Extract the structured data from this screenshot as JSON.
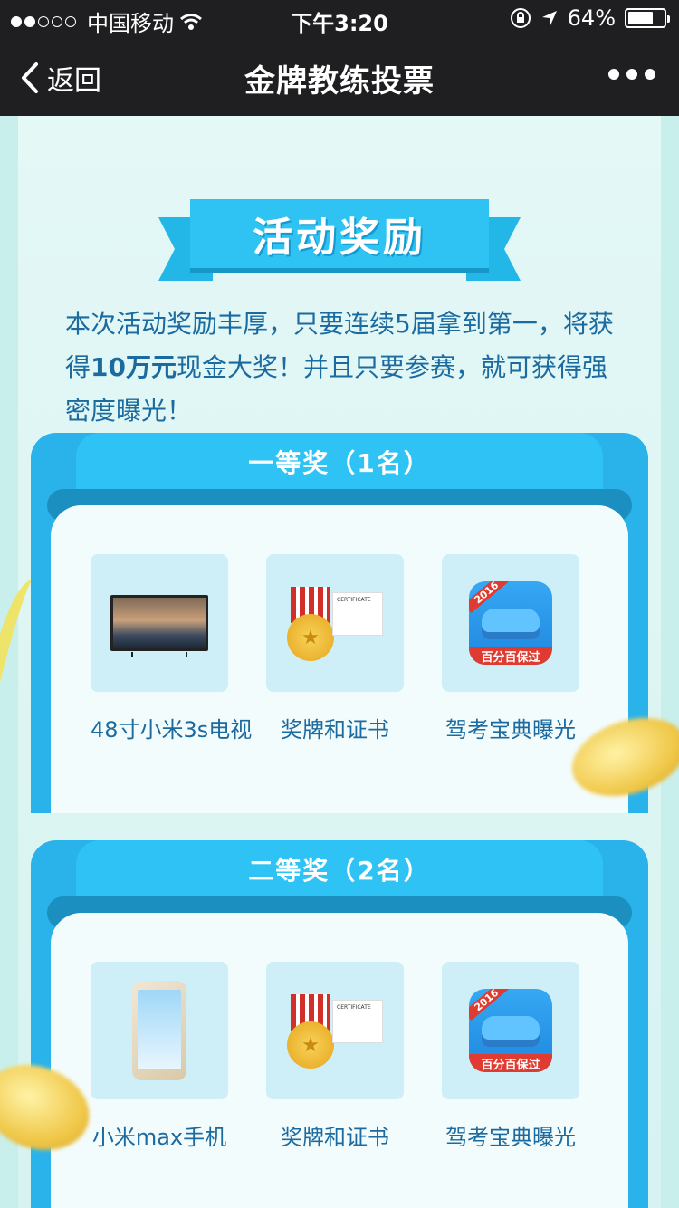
{
  "status_bar": {
    "carrier": "中国移动",
    "time": "下午3:20",
    "battery": "64%"
  },
  "nav": {
    "back_label": "返回",
    "title": "金牌教练投票"
  },
  "section": {
    "title": "活动奖励",
    "intro_part1": "本次活动奖励丰厚，只要连续5届拿到第一，将获得",
    "intro_bold": "10万元",
    "intro_part2": "现金大奖！并且只要参赛，就可获得强密度曝光！"
  },
  "prizes": [
    {
      "title": "一等奖（1名）",
      "items": [
        {
          "label": "48寸小米3s电视",
          "icon": "tv-icon"
        },
        {
          "label": "奖牌和证书",
          "icon": "medal-certificate-icon"
        },
        {
          "label": "驾考宝典曝光",
          "icon": "app-icon"
        }
      ]
    },
    {
      "title": "二等奖（2名）",
      "items": [
        {
          "label": "小米max手机",
          "icon": "phone-icon"
        },
        {
          "label": "奖牌和证书",
          "icon": "medal-certificate-icon"
        },
        {
          "label": "驾考宝典曝光",
          "icon": "app-icon"
        }
      ]
    }
  ],
  "app_icon_text": {
    "year": "2016",
    "banner": "百分百保过"
  },
  "certificate_text": "CERTIFICATE",
  "colors": {
    "header_bg": "#1f1f21",
    "accent_blue": "#2ec3f2",
    "text_blue": "#1b6aa0",
    "page_bg": "#dff6f5"
  }
}
